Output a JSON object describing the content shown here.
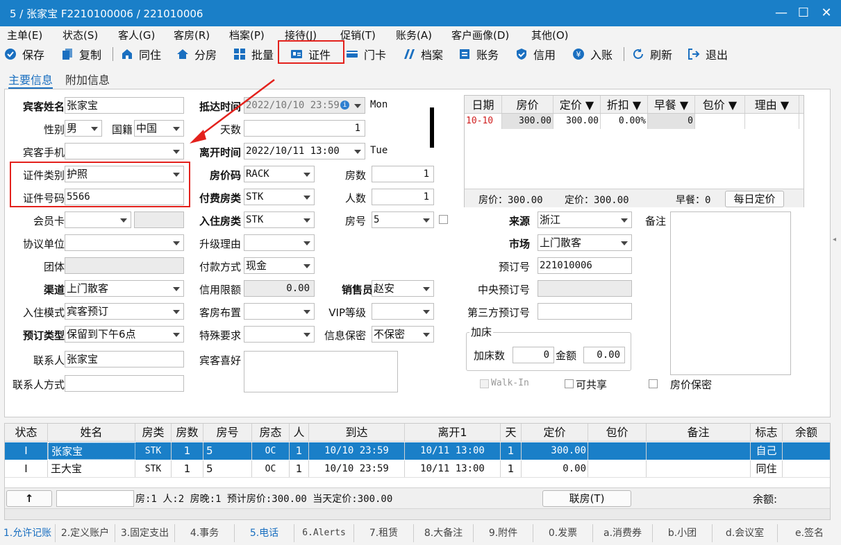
{
  "window": {
    "title": "5 / 张家宝  F2210100006 / 221010006"
  },
  "menu": [
    "主单(E)",
    "状态(S)",
    "客人(G)",
    "客房(R)",
    "档案(P)",
    "接待(J)",
    "促销(T)",
    "账务(A)",
    "客户画像(D)",
    "其他(O)"
  ],
  "toolbar": {
    "save": "保存",
    "copy": "复制",
    "share": "同住",
    "split": "分房",
    "batch": "批量",
    "id_doc": "证件",
    "door_card": "门卡",
    "archive": "档案",
    "account": "账务",
    "credit": "信用",
    "post": "入账",
    "refresh": "刷新",
    "exit": "退出"
  },
  "tabs": {
    "main": "主要信息",
    "extra": "附加信息"
  },
  "left": {
    "guest_name_label": "宾客姓名",
    "guest_name": "张家宝",
    "gender_label": "性别",
    "gender": "男",
    "nationality_label": "国籍",
    "nationality": "中国",
    "mobile_label": "宾客手机",
    "mobile": "",
    "id_type_label": "证件类别",
    "id_type": "护照",
    "id_no_label": "证件号码",
    "id_no": "5566",
    "member_card_label": "会员卡",
    "agreement_label": "协议单位",
    "group_label": "团体",
    "channel_label": "渠道",
    "channel": "上门散客",
    "checkin_mode_label": "入住模式",
    "checkin_mode": "宾客预订",
    "booking_type_label": "预订类型",
    "booking_type": "保留到下午6点",
    "contact_label": "联系人",
    "contact": "张家宝",
    "contact_method_label": "联系人方式"
  },
  "mid": {
    "arrival_label": "抵达时间",
    "arrival": "2022/10/10 23:59",
    "arrival_day": "Mon",
    "days_label": "天数",
    "days": "1",
    "depart_label": "离开时间",
    "depart": "2022/10/11 13:00",
    "depart_day": "Tue",
    "rate_code_label": "房价码",
    "rate_code": "RACK",
    "rooms_label": "房数",
    "rooms": "1",
    "pay_type_label": "付费房类",
    "pay_type": "STK",
    "persons_label": "人数",
    "persons": "1",
    "room_type_label": "入住房类",
    "room_type": "STK",
    "room_no_label": "房号",
    "room_no": "5",
    "upgrade_label": "升级理由",
    "payment_label": "付款方式",
    "payment": "现金",
    "credit_limit_label": "信用限额",
    "credit_limit": "0.00",
    "salesman_label": "销售员",
    "salesman": "赵安",
    "room_setup_label": "客房布置",
    "vip_label": "VIP等级",
    "special_label": "特殊要求",
    "privacy_label": "信息保密",
    "privacy": "不保密",
    "preference_label": "宾客喜好"
  },
  "rate_grid": {
    "headers": [
      "日期",
      "房价",
      "定价 ▼",
      "折扣 ▼",
      "早餐 ▼",
      "包价 ▼",
      "理由 ▼"
    ],
    "row": [
      "10-10",
      "300.00",
      "300.00",
      "0.00%",
      "0",
      "",
      ""
    ],
    "summary_price": "房价：300.00",
    "summary_fixed": "定价：300.00",
    "summary_breakfast": "早餐：0",
    "daily_button": "每日定价"
  },
  "right": {
    "source_label": "来源",
    "source": "浙江",
    "market_label": "市场",
    "market": "上门散客",
    "booking_no_label": "预订号",
    "booking_no": "221010006",
    "central_label": "中央预订号",
    "third_label": "第三方预订号",
    "remark_label": "备注",
    "extra_bed_title": "加床",
    "extra_bed_count_label": "加床数",
    "extra_bed_count": "0",
    "amount_label": "金额",
    "amount": "0.00",
    "walkin": "Walk-In",
    "shareable": "可共享",
    "rate_secret": "房价保密"
  },
  "guest_table": {
    "headers": [
      "状态",
      "姓名",
      "房类",
      "房数",
      "房号",
      "房态",
      "人",
      "到达",
      "离开1",
      "天",
      "定价",
      "包价",
      "备注",
      "标志",
      "余额"
    ],
    "rows": [
      [
        "I",
        "张家宝",
        "STK",
        "1",
        "5",
        "OC",
        "1",
        "10/10 23:59",
        "10/11 13:00",
        "1",
        "300.00",
        "",
        "",
        "自己",
        ""
      ],
      [
        "I",
        "王大宝",
        "STK",
        "1",
        "5",
        "OC",
        "1",
        "10/10 23:59",
        "10/11 13:00",
        "1",
        "0.00",
        "",
        "",
        "同住",
        ""
      ]
    ],
    "summary": "房:1  人:2  房晚:1  预计房价:300.00  当天定价:300.00",
    "up_arrow": "↑",
    "link_room_button": "联房(T)",
    "balance_label": "余额:"
  },
  "status_tabs": [
    "1.允许记账",
    "2.定义账户",
    "3.固定支出",
    "4.事务",
    "5.电话",
    "6.Alerts",
    "7.租赁",
    "8.大备注",
    "9.附件",
    "0.发票",
    "a.消费券",
    "b.小团",
    "d.会议室",
    "e.签名"
  ],
  "colors": {
    "title": "#1a7fc8",
    "selection": "#1a7fc8",
    "highlight_red": "#e3211c"
  }
}
